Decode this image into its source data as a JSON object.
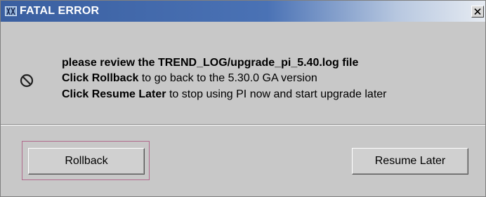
{
  "window": {
    "title": "FATAL ERROR",
    "icon": "app-icon",
    "close_icon": "close-icon"
  },
  "message": {
    "icon": "no-entry-icon",
    "line1": "please review the TREND_LOG/upgrade_pi_5.40.log file",
    "line2_bold": "Click Rollback",
    "line2_rest": " to go back to the 5.30.0 GA version",
    "line3_bold": "Click Resume Later",
    "line3_rest": " to stop using PI now and start upgrade later"
  },
  "buttons": {
    "rollback": "Rollback",
    "resume_later": "Resume Later"
  },
  "colors": {
    "titlebar_start": "#3a5fa0",
    "titlebar_end": "#e6ebf2",
    "dialog_background": "#c8c8c8",
    "focus_ring": "#b06a8c"
  }
}
